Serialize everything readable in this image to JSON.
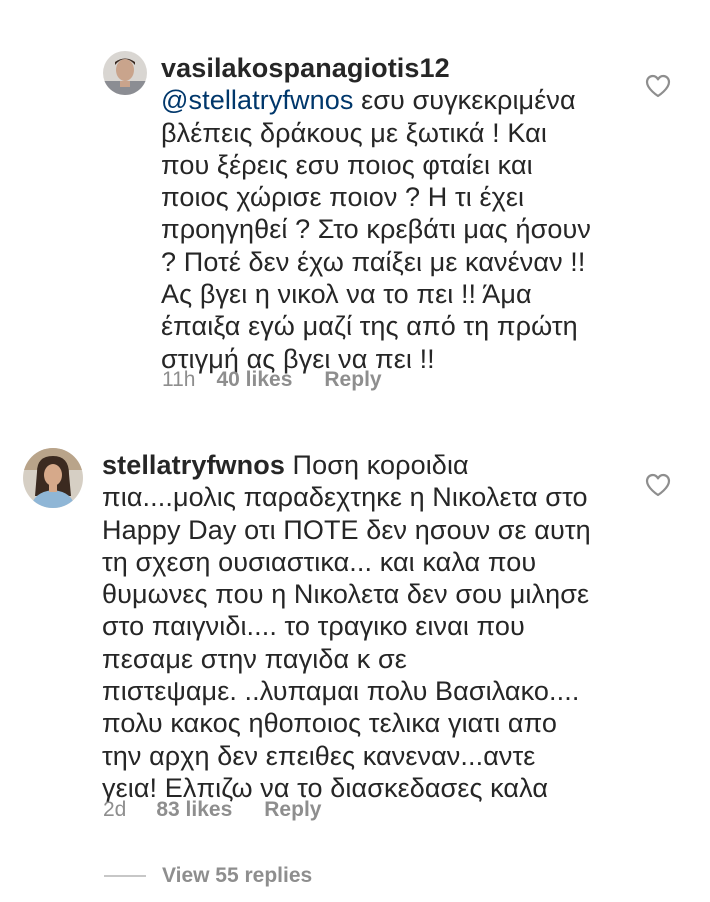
{
  "comments": [
    {
      "username": "vasilakospanagiotis12",
      "mention": "@stellatryfwnos",
      "text_after_mention": " εσυ συγκεκριμένα\nβλέπεις δράκους με ξωτικά ! Και\nπου ξέρεις εσυ ποιος φταίει και\nποιος χώρισε ποιον ? Η τι έχει\nπροηγηθεί ? Στο κρεβάτι μας ήσουν\n? Ποτέ δεν έχω παίξει με κανέναν !!\nΑς βγει η νικολ να το πει !! Άμα\nέπαιξα εγώ μαζί της από τη πρώτη\nστιγμή ας βγει να πει !!",
      "time": "11h",
      "likes": "40 likes",
      "reply": "Reply",
      "like_icon": "heart-outline-icon"
    },
    {
      "username": "stellatryfwnos",
      "text": " Ποση κοροιδια\nπια....μολις παραδεχτηκε η Νικολετα στο\nHappy Day οτι ΠΟΤΕ δεν ησουν σε αυτη\nτη σχεση ουσιαστικα... και καλα που\nθυμωνες που η Νικολετα δεν σου μιλησε\nστο παιγνιδι.... το τραγικο ειναι που\nπεσαμε στην παγιδα κ σε\nπιστεψαμε. ..λυπαμαι πολυ Βασιλακο....\nπολυ κακος ηθοποιος τελικα  γιατι απο\nτην αρχη δεν επειθες κανεναν...αντε\nγεια!  Ελπιζω να το διασκεδασες καλα",
      "time": "2d",
      "likes": "83 likes",
      "reply": "Reply",
      "like_icon": "heart-outline-icon"
    }
  ],
  "view_replies": "View 55 replies",
  "colors": {
    "text": "#262626",
    "mention": "#00376b",
    "meta": "#8e8e8e"
  }
}
